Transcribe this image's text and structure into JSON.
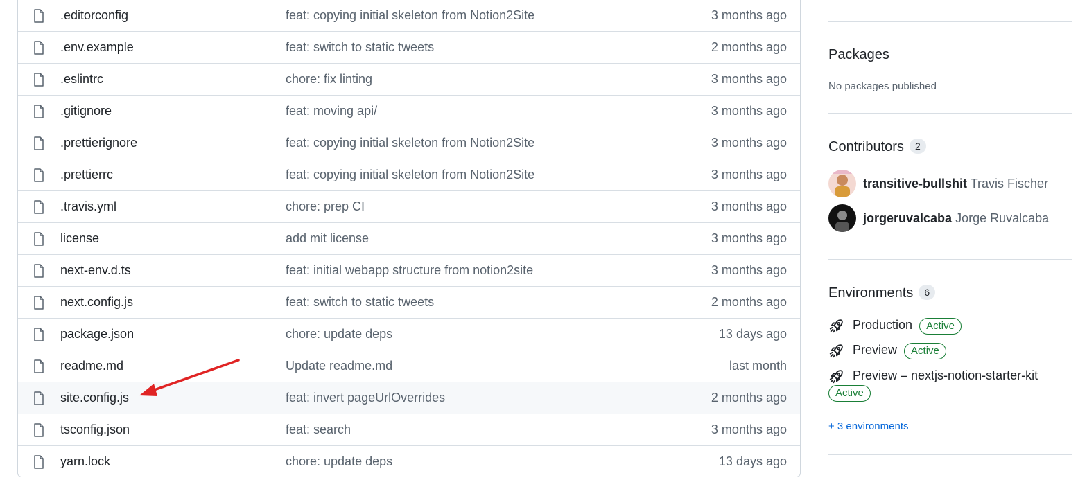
{
  "files": [
    {
      "name": ".editorconfig",
      "message": "feat: copying initial skeleton from Notion2Site",
      "age": "3 months ago"
    },
    {
      "name": ".env.example",
      "message": "feat: switch to static tweets",
      "age": "2 months ago"
    },
    {
      "name": ".eslintrc",
      "message": "chore: fix linting",
      "age": "3 months ago"
    },
    {
      "name": ".gitignore",
      "message": "feat: moving api/",
      "age": "3 months ago"
    },
    {
      "name": ".prettierignore",
      "message": "feat: copying initial skeleton from Notion2Site",
      "age": "3 months ago"
    },
    {
      "name": ".prettierrc",
      "message": "feat: copying initial skeleton from Notion2Site",
      "age": "3 months ago"
    },
    {
      "name": ".travis.yml",
      "message": "chore: prep CI",
      "age": "3 months ago"
    },
    {
      "name": "license",
      "message": "add mit license",
      "age": "3 months ago"
    },
    {
      "name": "next-env.d.ts",
      "message": "feat: initial webapp structure from notion2site",
      "age": "3 months ago"
    },
    {
      "name": "next.config.js",
      "message": "feat: switch to static tweets",
      "age": "2 months ago"
    },
    {
      "name": "package.json",
      "message": "chore: update deps",
      "age": "13 days ago"
    },
    {
      "name": "readme.md",
      "message": "Update readme.md",
      "age": "last month"
    },
    {
      "name": "site.config.js",
      "message": "feat: invert pageUrlOverrides",
      "age": "2 months ago"
    },
    {
      "name": "tsconfig.json",
      "message": "feat: search",
      "age": "3 months ago"
    },
    {
      "name": "yarn.lock",
      "message": "chore: update deps",
      "age": "13 days ago"
    }
  ],
  "highlighted_file": "site.config.js",
  "sidebar": {
    "packages": {
      "title": "Packages",
      "empty_text": "No packages published"
    },
    "contributors": {
      "title": "Contributors",
      "count": "2",
      "items": [
        {
          "login": "transitive-bullshit",
          "name": "Travis Fischer"
        },
        {
          "login": "jorgeruvalcaba",
          "name": "Jorge Ruvalcaba"
        }
      ]
    },
    "environments": {
      "title": "Environments",
      "count": "6",
      "items": [
        {
          "name": "Production",
          "status": "Active"
        },
        {
          "name": "Preview",
          "status": "Active"
        },
        {
          "name": "Preview – nextjs-notion-starter-kit",
          "status": "Active"
        }
      ],
      "more_link": "+ 3 environments"
    }
  },
  "annotation": {
    "arrow_color": "#e02424"
  },
  "icons": {
    "file": "file-icon",
    "rocket": "rocket-icon"
  }
}
